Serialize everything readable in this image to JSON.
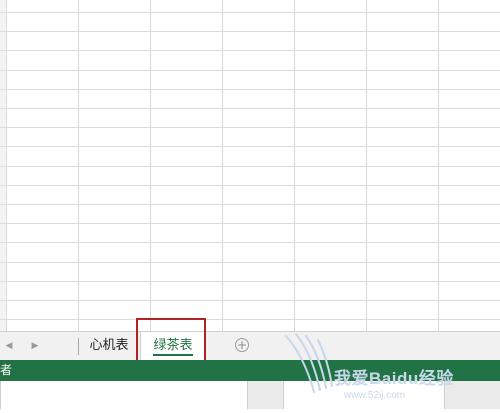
{
  "sheet_tabs": [
    {
      "label": "心机表",
      "active": false
    },
    {
      "label": "绿茶表",
      "active": true
    }
  ],
  "nav": {
    "prev_icon": "◀",
    "next_icon": "▶"
  },
  "add_sheet_icon": "+",
  "status": {
    "text": "者"
  },
  "watermark": {
    "text": "我爱Baidu经验",
    "url": "www.52ij.com"
  },
  "colors": {
    "accent": "#217346",
    "highlight": "#b22222"
  }
}
